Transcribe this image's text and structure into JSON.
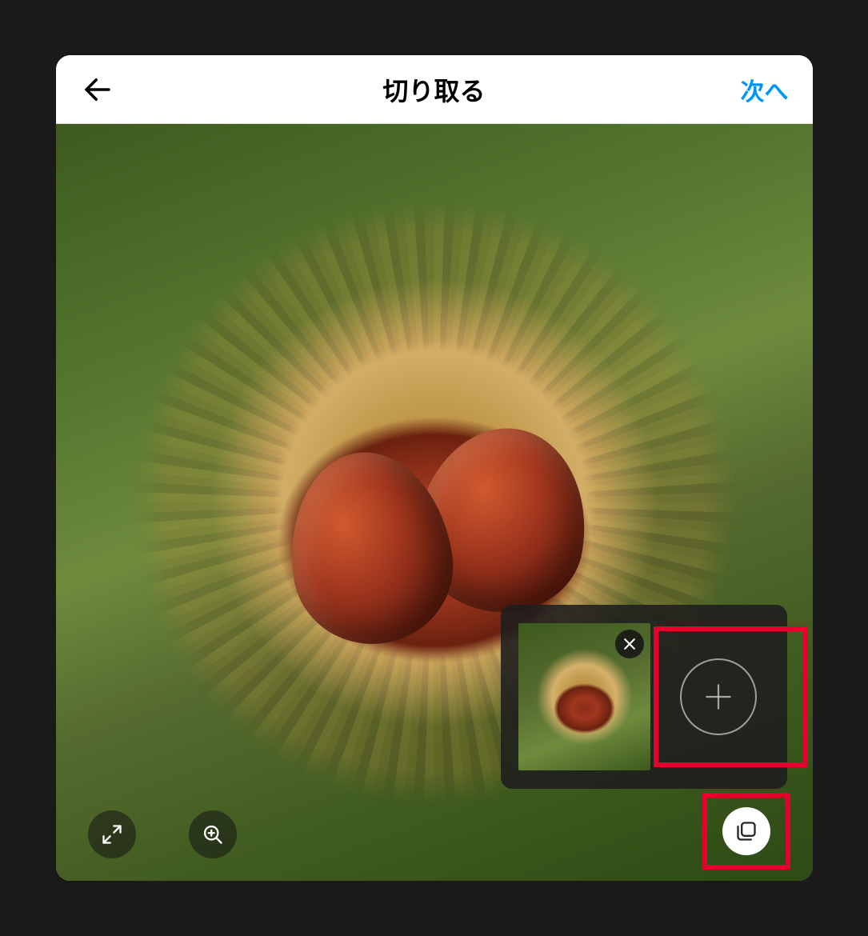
{
  "header": {
    "title": "切り取る",
    "next_label": "次へ"
  },
  "icons": {
    "back": "back-arrow-icon",
    "close": "close-icon",
    "plus": "plus-icon",
    "expand": "expand-icon",
    "zoom": "zoom-in-icon",
    "gallery": "multi-select-icon"
  },
  "colors": {
    "accent": "#0095f6",
    "highlight": "#e6002d"
  }
}
